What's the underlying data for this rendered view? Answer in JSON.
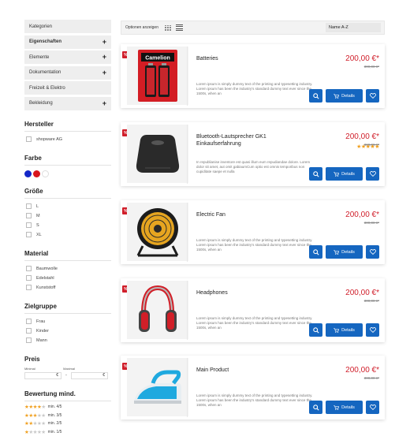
{
  "sidebar": {
    "categories": [
      {
        "label": "Kategorien",
        "plus": ""
      },
      {
        "label": "Eigenschaften",
        "plus": "+"
      },
      {
        "label": "Elemente",
        "plus": "+"
      },
      {
        "label": "Dokumentation",
        "plus": "+"
      },
      {
        "label": "Freizeit & Elektro",
        "plus": ""
      },
      {
        "label": "Bekleidung",
        "plus": "+"
      }
    ],
    "hersteller": {
      "title": "Hersteller",
      "items": [
        "shopware AG"
      ]
    },
    "farbe": {
      "title": "Farbe",
      "colors": [
        "#1428c8",
        "#d8161e",
        "#ffffff"
      ]
    },
    "groesse": {
      "title": "Größe",
      "items": [
        "L",
        "M",
        "S",
        "XL"
      ]
    },
    "material": {
      "title": "Material",
      "items": [
        "Baumwolle",
        "Edelstahl",
        "Kunststoff"
      ]
    },
    "zielgruppe": {
      "title": "Zielgruppe",
      "items": [
        "Frau",
        "Kinder",
        "Mann"
      ]
    },
    "preis": {
      "title": "Preis",
      "min_label": "Minimal",
      "max_label": "Maximal",
      "currency": "€",
      "separator": "-"
    },
    "bewertung": {
      "title": "Bewertung mind.",
      "rows": [
        {
          "stars": 4,
          "label": "min. 4/5"
        },
        {
          "stars": 3,
          "label": "min. 3/5"
        },
        {
          "stars": 2,
          "label": "min. 2/5"
        },
        {
          "stars": 1,
          "label": "min. 1/5"
        }
      ]
    }
  },
  "toolbar": {
    "options_label": "Optionen anzeigen",
    "sort_value": "Name A-Z"
  },
  "products": [
    {
      "name": "Batteries",
      "desc": "Lorem ipsum is simply dummy text of the printing and typesetting industry. Lorem ipsum has been the industry's standard dummy text ever since the 1500s, when an",
      "price": "200,00 €*",
      "old_price": "300,00 €*",
      "rating": "",
      "details": "Details",
      "sale": "%",
      "image": "battery"
    },
    {
      "name": "Bluetooth-Lautsprecher GK1 Einkaufserfahrung",
      "desc": "In republianise inventore est quasi illum eum repudiandae dolore. Lorem dolor sit amet, aut omit gabiaumCum optio est omnis temporibus non cupiditate saepe et nulla",
      "price": "200,00 €*",
      "old_price": "300,00 €*",
      "rating": "★★★★★",
      "details": "Details",
      "sale": "%",
      "image": "speaker"
    },
    {
      "name": "Electric Fan",
      "desc": "Lorem ipsum is simply dummy text of the printing and typesetting industry. Lorem ipsum has been the industry's standard dummy text ever since the 1500s, when an",
      "price": "200,00 €*",
      "old_price": "300,00 €*",
      "rating": "",
      "details": "Details",
      "sale": "%",
      "image": "fan"
    },
    {
      "name": "Headphones",
      "desc": "Lorem ipsum is simply dummy text of the printing and typesetting industry. Lorem ipsum has been the industry's standard dummy text ever since the 1500s, when an",
      "price": "200,00 €*",
      "old_price": "300,00 €*",
      "rating": "",
      "details": "Details",
      "sale": "%",
      "image": "headphones"
    },
    {
      "name": "Main Product",
      "desc": "Lorem ipsum is simply dummy text of the printing and typesetting industry. Lorem ipsum has been the industry's standard dummy text ever since the 1500s, when an",
      "price": "200,00 €*",
      "old_price": "300,00 €*",
      "rating": "",
      "details": "Details",
      "sale": "%",
      "image": "iron"
    }
  ],
  "icons": {
    "search": "search-icon",
    "cart": "cart-icon",
    "wishlist": "heart-icon",
    "grid": "grid-view-icon",
    "list": "list-view-icon"
  }
}
